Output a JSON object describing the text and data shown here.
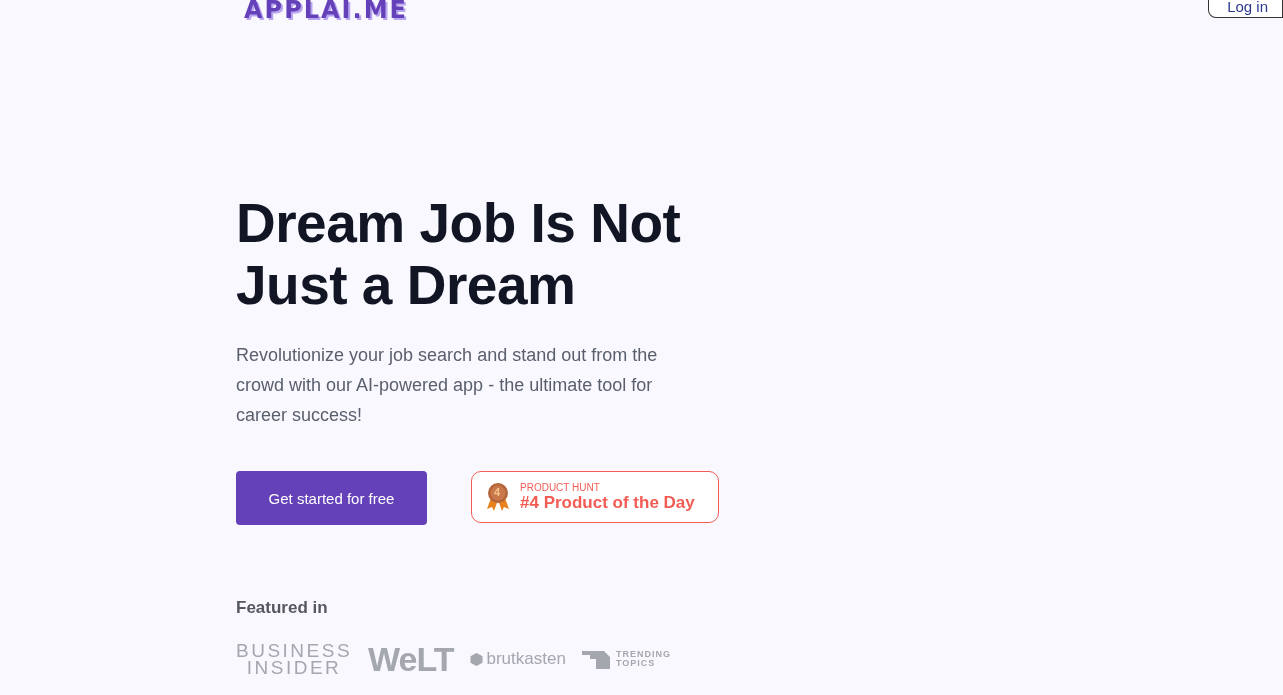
{
  "header": {
    "logo": "APPLAI.ME",
    "login": "Log in"
  },
  "hero": {
    "title_lines": [
      "Dream Job Is Not",
      "Just a Dream"
    ],
    "subtitle": "Revolutionize your job search and stand out from the crowd with our AI-powered app - the ultimate tool for career success!",
    "cta": "Get started for free",
    "badge": {
      "rank": "4",
      "eyebrow": "PRODUCT HUNT",
      "text": "#4 Product of the Day"
    }
  },
  "featured": {
    "heading": "Featured in",
    "logos": [
      {
        "kind": "stacked",
        "lines": [
          "BUSINESS",
          "INSIDER"
        ]
      },
      {
        "kind": "bold",
        "lines": [
          "WeLT"
        ]
      },
      {
        "kind": "dot",
        "lines": [
          "brutkasten"
        ]
      },
      {
        "kind": "mark",
        "lines": [
          "TRENDING",
          "TOPICS"
        ]
      }
    ]
  }
}
